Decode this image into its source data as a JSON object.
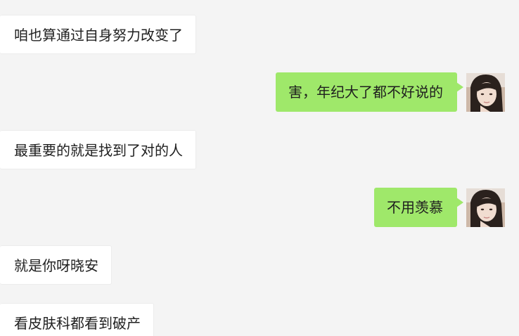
{
  "messages": [
    {
      "side": "incoming",
      "text": "咱也算通过自身努力改变了"
    },
    {
      "side": "outgoing",
      "text": "害，年纪大了都不好说的"
    },
    {
      "side": "incoming",
      "text": "最重要的就是找到了对的人"
    },
    {
      "side": "outgoing",
      "text": "不用羡慕"
    },
    {
      "side": "incoming",
      "text": "就是你呀晓安"
    },
    {
      "side": "incoming",
      "text": "看皮肤科都看到破产"
    }
  ],
  "avatar_icon": "user-photo-avatar",
  "colors": {
    "background": "#f4f4f4",
    "incoming_bubble": "#ffffff",
    "outgoing_bubble": "#9fe86a",
    "text": "#1f1f1f"
  }
}
